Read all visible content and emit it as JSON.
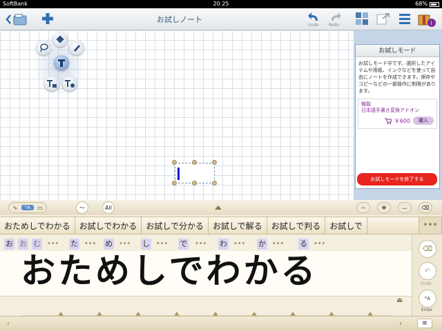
{
  "status_bar": {
    "carrier": "SoftBank",
    "time": "20:25",
    "battery": "68%"
  },
  "toolbar": {
    "title": "お試しノート",
    "undo_label": "Undo",
    "redo_label": "Redo",
    "brand_color": "#2f6fb0"
  },
  "trial_panel": {
    "title": "お試しモード",
    "description": "お試しモード中です。選択したアイテムや用紙、インクなどを使って自由にノートを作成できます。保存やコピーなどの一部操作に制限があります。",
    "addon_heading": "機能",
    "addon_name": "日本語手書き変換アドオン",
    "price": "￥600",
    "buy_label": "購入",
    "end_button": "お試しモードを終了する",
    "end_button_color": "#e8241e"
  },
  "input_modes": {
    "all_label": "All"
  },
  "candidates": [
    "おためしでわかる",
    "お試しでわかる",
    "お試しで分かる",
    "お試しで解る",
    "お試しで判る",
    "お試しで"
  ],
  "candidates_more": "•••",
  "characters": [
    "お",
    "お",
    "む",
    "た",
    "め",
    "し",
    "で",
    "わ",
    "か",
    "る"
  ],
  "char_dots": "•••",
  "handwriting": "おためしでわかる",
  "side_buttons": {
    "undo_label": "Undo",
    "enter_label": "Enter"
  }
}
